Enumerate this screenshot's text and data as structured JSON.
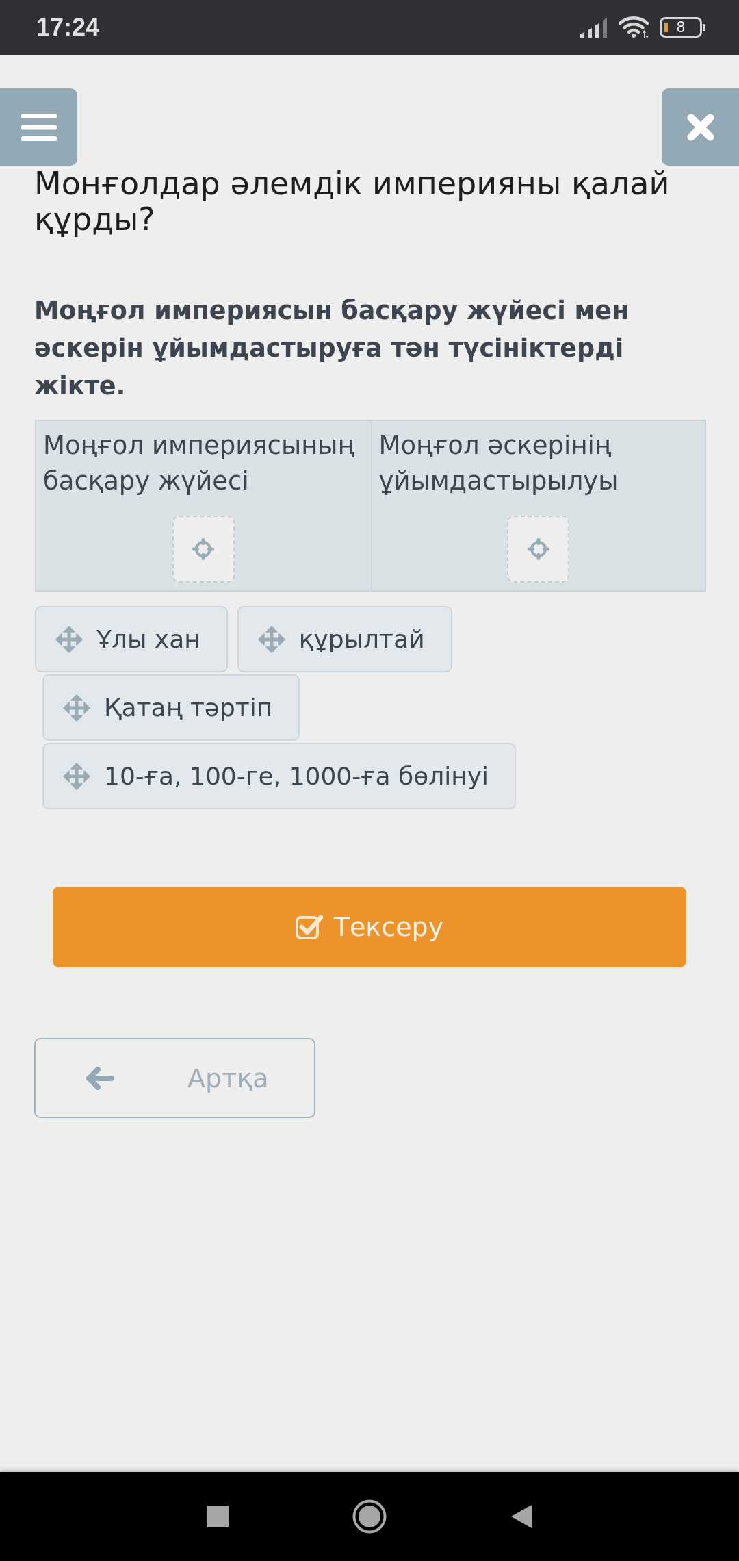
{
  "status_bar": {
    "time": "17:24",
    "battery": "8"
  },
  "title": "Монғолдар әлемдік империяны қалай құрды?",
  "instruction": "Моңғол империясын басқару жүйесі мен әскерін ұйымдастыруға тән түсініктерді жікте.",
  "categories": [
    {
      "label": "Моңғол империясының басқару жүйесі"
    },
    {
      "label": "Моңғол әскерінің ұйымдастырылуы"
    }
  ],
  "items": [
    {
      "label": "Ұлы хан"
    },
    {
      "label": "құрылтай"
    },
    {
      "label": "Қатаң тәртіп"
    },
    {
      "label": "10-ға, 100-ге, 1000-ға бөлінуі"
    }
  ],
  "check_button": {
    "label": "Тексеру"
  },
  "back_button": {
    "label": "Артқа"
  }
}
